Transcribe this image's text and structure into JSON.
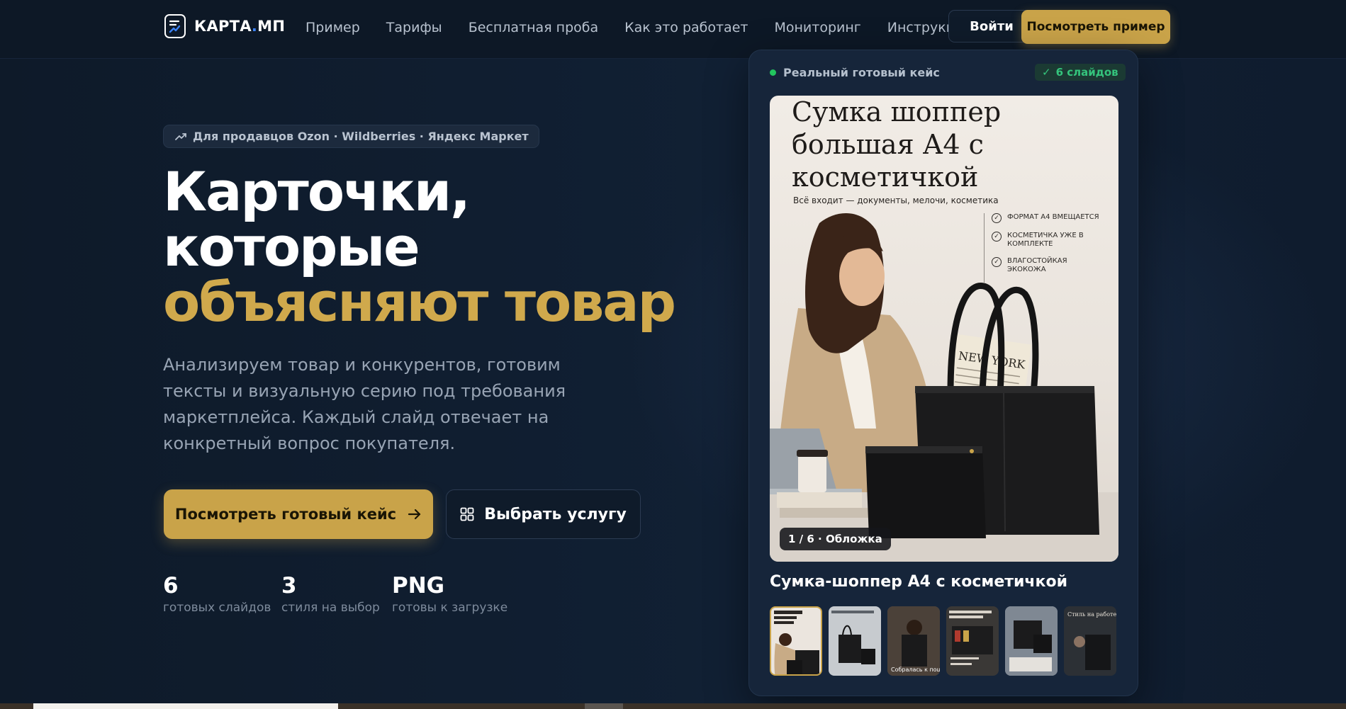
{
  "nav": {
    "logo_text": "КАРТА",
    "logo_dot": ".",
    "logo_suffix": "МП",
    "links": [
      "Пример",
      "Тарифы",
      "Бесплатная проба",
      "Как это работает",
      "Мониторинг",
      "Инструкции"
    ],
    "login_label": "Войти",
    "cta_label": "Посмотреть пример"
  },
  "hero": {
    "pill_text": "Для продавцов Ozon · Wildberries · Яндекс Маркет",
    "title_line1": "Карточки,",
    "title_line2": "которые",
    "title_line3": "объясняют товар",
    "lead": "Анализируем товар и конкурентов, готовим тексты и визуальную серию под требования маркетплейса. Каждый слайд отвечает на конкретный вопрос покупателя.",
    "primary_cta": "Посмотреть готовый кейс",
    "secondary_cta": "Выбрать услугу",
    "stats": [
      {
        "value": "6",
        "label": "готовых слайдов"
      },
      {
        "value": "3",
        "label": "стиля на выбор"
      },
      {
        "value": "PNG",
        "label": "готовы к загрузке"
      }
    ]
  },
  "card": {
    "case_label": "Реальный готовый кейс",
    "slides_badge": "6 слайдов",
    "slide_title": "Сумка шоппер большая А4 с косметичкой",
    "slide_subtitle": "Всё входит — документы, мелочи, косметика",
    "slide_bullets": [
      "ФОРМАТ А4 ВМЕЩАЕТСЯ",
      "КОСМЕТИЧКА УЖЕ В КОМПЛЕКТЕ",
      "ВЛАГОСТОЙКАЯ ЭКОКОЖА"
    ],
    "slide_tag": "1 / 6 · Обложка",
    "newspaper_text": "NEW YORK",
    "product_title": "Сумка-шоппер А4 с косметичкой",
    "thumb_captions": [
      "",
      "",
      "Собралась к пошле",
      "",
      "",
      "Стиль на работе"
    ]
  },
  "colors": {
    "accent": "#c9a349",
    "background": "#0f1b2b",
    "success": "#22c55e"
  }
}
